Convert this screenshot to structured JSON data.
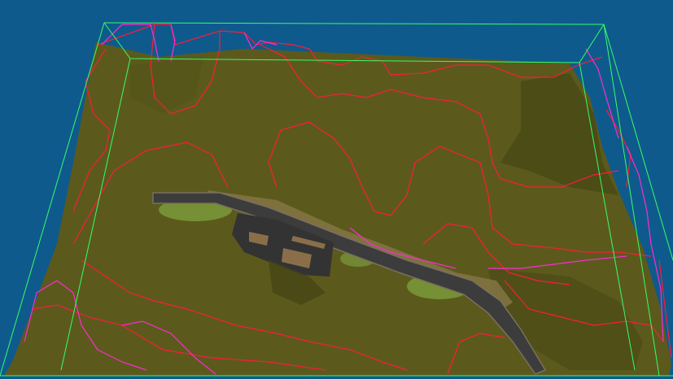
{
  "viewport": {
    "background_color": "#0f5a8c",
    "terrain_color": "#5b5a1c",
    "terrain_dark_color": "#4a4a16",
    "road_color": "#3c3c3c",
    "road_edge_color": "#7a6f60",
    "embankment_color": "#8a7a4a",
    "grass_color": "#7a9a3a",
    "building_color": "#8a6e4a",
    "lot_color": "#333333",
    "bounding_box_color": "#33ff66",
    "contour_colors": [
      "#ff1a3a",
      "#ff2ad4"
    ]
  }
}
